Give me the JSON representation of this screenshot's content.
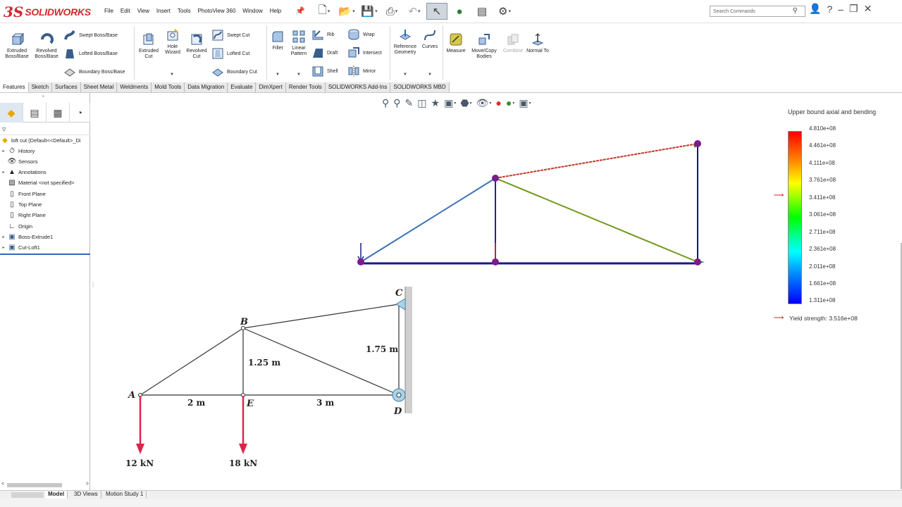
{
  "app": {
    "brand": "SOLIDWORKS",
    "brand_mark": "3S"
  },
  "menu": [
    "File",
    "Edit",
    "View",
    "Insert",
    "Tools",
    "PhotoView 360",
    "Window",
    "Help"
  ],
  "search": {
    "placeholder": "Search Commands"
  },
  "commands": {
    "extruded_boss": "Extruded Boss/Base",
    "revolved_boss": "Revolved Boss/Base",
    "swept_boss": "Swept Boss/Base",
    "lofted_boss": "Lofted Boss/Base",
    "boundary_boss": "Boundary Boss/Base",
    "extruded_cut": "Extruded Cut",
    "hole_wizard": "Hole Wizard",
    "revolved_cut": "Revolved Cut",
    "swept_cut": "Swept Cut",
    "lofted_cut": "Lofted Cut",
    "boundary_cut": "Boundary Cut",
    "fillet": "Fillet",
    "linear_pattern": "Linear Pattern",
    "rib": "Rib",
    "draft": "Draft",
    "shell": "Shell",
    "wrap": "Wrap",
    "intersect": "Intersect",
    "mirror": "Mirror",
    "reference_geometry": "Reference Geometry",
    "curves": "Curves",
    "measure": "Measure",
    "move_copy": "Move/Copy Bodies",
    "combine": "Combine",
    "normal_to": "Normal To"
  },
  "tabs": [
    "Features",
    "Sketch",
    "Surfaces",
    "Sheet Metal",
    "Weldments",
    "Mold Tools",
    "Data Migration",
    "Evaluate",
    "DimXpert",
    "Render Tools",
    "SOLIDWORKS Add-Ins",
    "SOLIDWORKS MBD"
  ],
  "tree": {
    "root": "loft cut  (Default<<Default>_Di",
    "items": [
      "History",
      "Sensors",
      "Annotations",
      "Material <not specified>",
      "Front Plane",
      "Top Plane",
      "Right Plane",
      "Origin",
      "Boss-Extrude1",
      "Cut-Loft1"
    ]
  },
  "bottom_tabs": [
    "Model",
    "3D Views",
    "Motion Study 1"
  ],
  "legend": {
    "title": "Upper bound axial and bending",
    "values": [
      "4.810e+08",
      "4.461e+08",
      "4.111e+08",
      "3.761e+08",
      "3.411e+08",
      "3.061e+08",
      "2.711e+08",
      "2.361e+08",
      "2.011e+08",
      "1.661e+08",
      "1.311e+08"
    ],
    "yield": "Yield strength: 3.516e+08",
    "colors": {
      "max": "#ff0000",
      "mid": "#00ff00",
      "min": "#0000ff"
    }
  },
  "sketch": {
    "labels": {
      "A": "A",
      "B": "B",
      "C": "C",
      "D": "D",
      "E": "E"
    },
    "dims": {
      "ae": "2 m",
      "ed": "3 m",
      "be": "1.25 m",
      "cd": "1.75 m"
    },
    "loads": {
      "a": "12 kN",
      "e": "18 kN"
    }
  }
}
